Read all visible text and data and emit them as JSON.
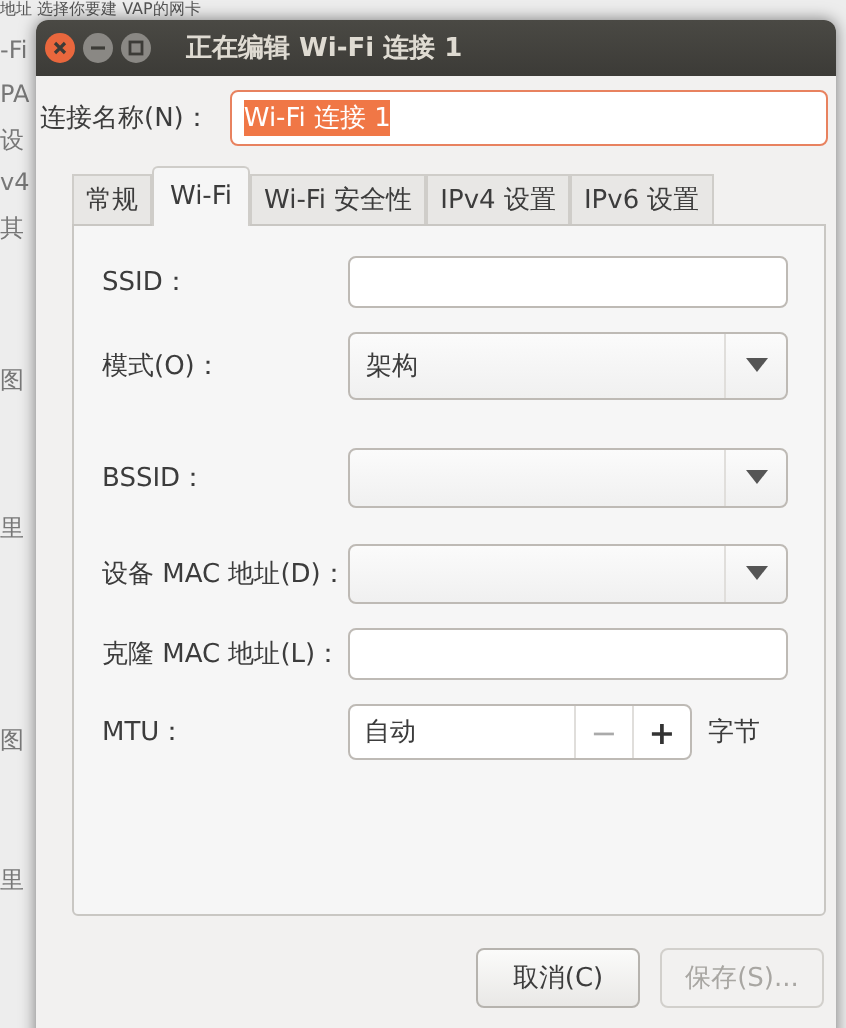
{
  "background": {
    "header": "地址 选择你要建 VAP的网卡",
    "fragments": [
      "-Fi",
      "PA",
      "设",
      "v4",
      "其",
      "图",
      "里",
      "图",
      "里"
    ]
  },
  "window": {
    "title": "正在编辑 Wi-Fi 连接 1"
  },
  "connection_name": {
    "label": "连接名称(N)：",
    "value": "Wi-Fi 连接 1",
    "selected": true
  },
  "tabs": [
    {
      "label": "常规",
      "selected": false
    },
    {
      "label": "Wi-Fi",
      "selected": true
    },
    {
      "label": "Wi-Fi 安全性",
      "selected": false
    },
    {
      "label": "IPv4 设置",
      "selected": false
    },
    {
      "label": "IPv6 设置",
      "selected": false
    }
  ],
  "fields": [
    {
      "kind": "entry",
      "label": "SSID："
    },
    {
      "kind": "combo",
      "label": "模式(O)：",
      "value": "架构"
    },
    {
      "kind": "combo",
      "label": "BSSID："
    },
    {
      "kind": "combo",
      "label": "设备 MAC 地址(D)："
    },
    {
      "kind": "entry",
      "label": "克隆 MAC 地址(L)："
    },
    {
      "kind": "spin",
      "label": "MTU：",
      "value": "自动",
      "minus": "−",
      "plus": "+",
      "unit": "字节"
    }
  ],
  "buttons": [
    {
      "label": "取消(C)",
      "disabled": false
    },
    {
      "label": "保存(S)...",
      "disabled": true
    }
  ]
}
